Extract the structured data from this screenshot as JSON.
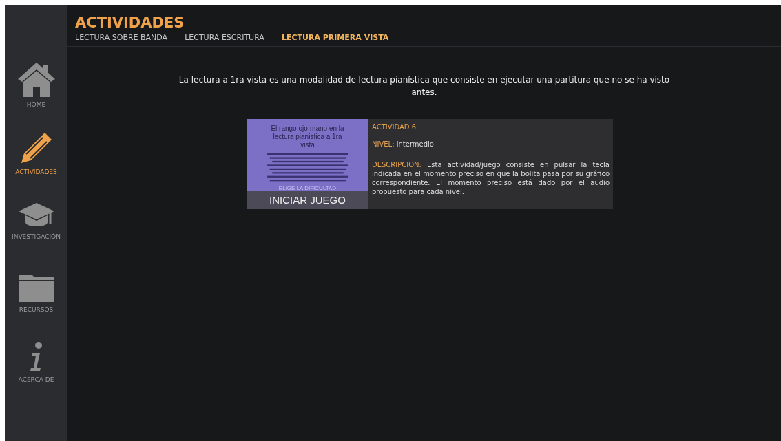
{
  "sidebar": {
    "items": [
      {
        "label": "HOME",
        "kind": "home",
        "selected": false
      },
      {
        "label": "ACTIVIDADES",
        "kind": "pencil",
        "selected": true
      },
      {
        "label": "INVESTIGACIÓN",
        "kind": "cap",
        "selected": false
      },
      {
        "label": "RECURSOS",
        "kind": "folder",
        "selected": false
      },
      {
        "label": "ACERCA DE",
        "kind": "info",
        "selected": false
      }
    ]
  },
  "header": {
    "title": "ACTIVIDADES",
    "tabs": [
      {
        "label": "LECTURA SOBRE BANDA",
        "selected": false
      },
      {
        "label": "LECTURA ESCRITURA",
        "selected": false
      },
      {
        "label": "LECTURA PRIMERA VISTA",
        "selected": true
      }
    ]
  },
  "intro": "La lectura a 1ra vista es una modalidad de lectura pianística que consiste en ejecutar una partitura que no se ha visto antes.",
  "activity": {
    "thumbnail": {
      "title": "El rango ojo-mano en la lectura pianistica a 1ra vista",
      "hint": "ELIGE LA DIFICULTAD",
      "button": "INICIAR JUEGO"
    },
    "name": "ACTIVIDAD 6",
    "level_label": "NIVEL:",
    "level_value": "intermedio",
    "description_label": "DESCRIPCION:",
    "description": "Esta actividad/juego consiste en pulsar la tecla indicada en el momento preciso en que la bolita pasa por su gráfico correspondiente. El momento preciso está dado por el audio propuesto para cada nivel."
  }
}
